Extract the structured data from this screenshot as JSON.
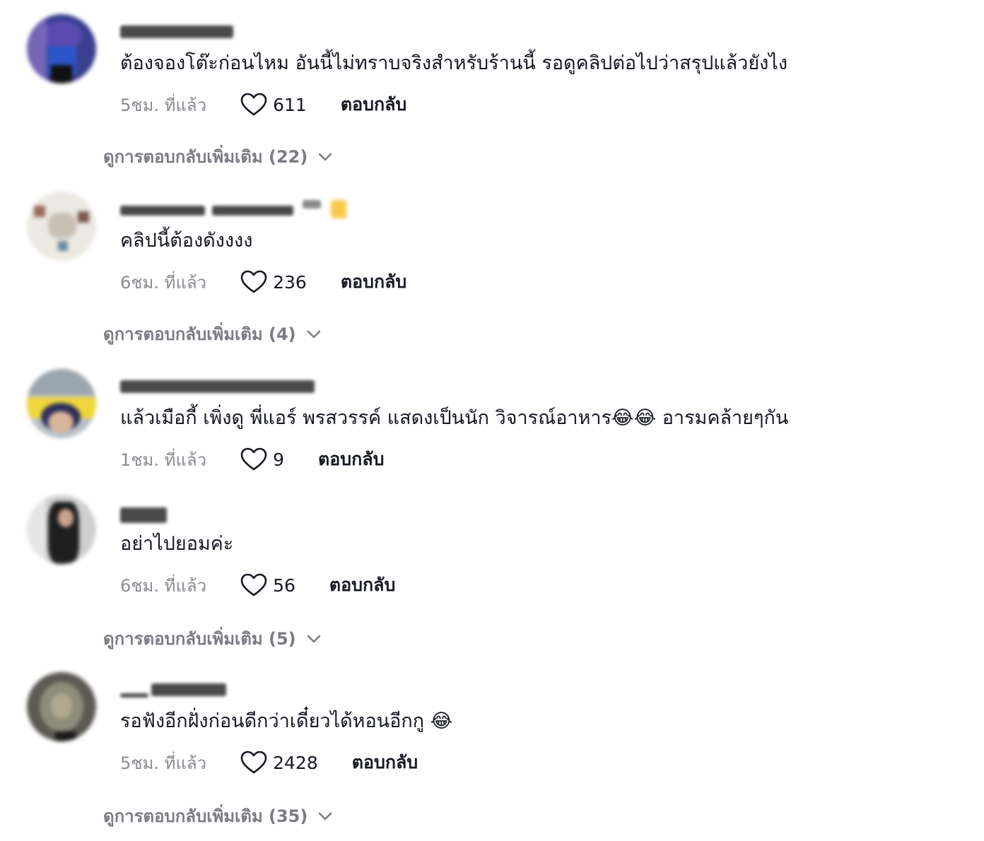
{
  "comments": [
    {
      "text": "ต้องจองโต๊ะก่อนไหม อันนี้ไม่ทราบจริงสำหรับร้านนี้ รอดูคลิปต่อไปว่าสรุปแล้วยังไง",
      "time": "5ชม. ที่แล้ว",
      "likes": "611",
      "reply_label": "ตอบกลับ",
      "view_more": "ดูการตอบกลับเพิ่มเติม (22)"
    },
    {
      "text": "คลิปนี้ต้องดังงงง",
      "time": "6ชม. ที่แล้ว",
      "likes": "236",
      "reply_label": "ตอบกลับ",
      "view_more": "ดูการตอบกลับเพิ่มเติม (4)"
    },
    {
      "text": "แล้วเมือกี้ เพิ่งดู พี่แอร์ พรสวรรค์ แสดงเป็นนัก วิจารณ์อาหาร😂😂 อารมคล้ายๆกัน",
      "time": "1ชม. ที่แล้ว",
      "likes": "9",
      "reply_label": "ตอบกลับ",
      "view_more": ""
    },
    {
      "text": "อย่าไปยอมค่ะ",
      "time": "6ชม. ที่แล้ว",
      "likes": "56",
      "reply_label": "ตอบกลับ",
      "view_more": "ดูการตอบกลับเพิ่มเติม (5)"
    },
    {
      "text": "รอฟังอีกฝั่งก่อนดีกว่าเดี๋ยวได้หอนอีกกู 😂",
      "time": "5ชม. ที่แล้ว",
      "likes": "2428",
      "reply_label": "ตอบกลับ",
      "view_more": "ดูการตอบกลับเพิ่มเติม (35)"
    }
  ],
  "icons": {
    "like": "heart-outline-icon",
    "expand": "chevron-down-icon"
  },
  "colors": {
    "text_primary": "#161823",
    "text_secondary": "#8a8b91",
    "view_more": "#7b7c83"
  }
}
